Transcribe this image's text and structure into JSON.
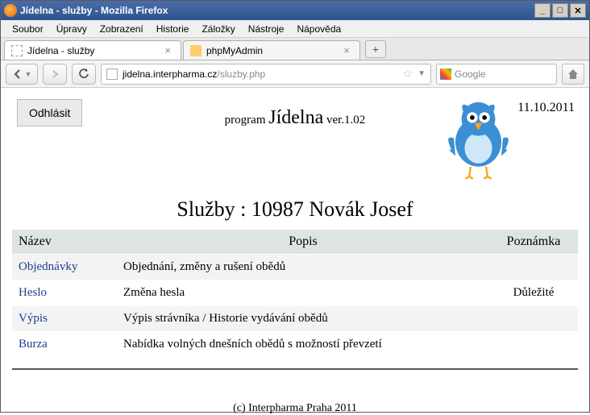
{
  "window": {
    "title": "Jídelna - služby - Mozilla Firefox"
  },
  "menu": {
    "soubor": "Soubor",
    "upravy": "Úpravy",
    "zobrazeni": "Zobrazení",
    "historie": "Historie",
    "zalozky": "Záložky",
    "nastroje": "Nástroje",
    "napoveda": "Nápověda"
  },
  "tabs": {
    "t1": "Jídelna - služby",
    "t2": "phpMyAdmin",
    "plus": "+"
  },
  "nav": {
    "url_host": "jidelna.interpharma.cz",
    "url_path": "/sluzby.php",
    "search_placeholder": "Google"
  },
  "page": {
    "logout": "Odhlásit",
    "program_prefix": "program ",
    "program_name": "Jídelna",
    "program_version": " ver.1.02",
    "date": "11.10.2011",
    "heading": "Služby : 10987 Novák Josef",
    "th_name": "Název",
    "th_desc": "Popis",
    "th_note": "Poznámka",
    "rows": [
      {
        "name": "Objednávky",
        "desc": "Objednání, změny a rušení obědů",
        "note": ""
      },
      {
        "name": "Heslo",
        "desc": "Změna hesla",
        "note": "Důležité"
      },
      {
        "name": "Výpis",
        "desc": "Výpis strávníka / Historie vydávání obědů",
        "note": ""
      },
      {
        "name": "Burza",
        "desc": "Nabídka volných dnešních obědů s možností převzetí",
        "note": ""
      }
    ],
    "footer": "(c) Interpharma Praha 2011"
  }
}
